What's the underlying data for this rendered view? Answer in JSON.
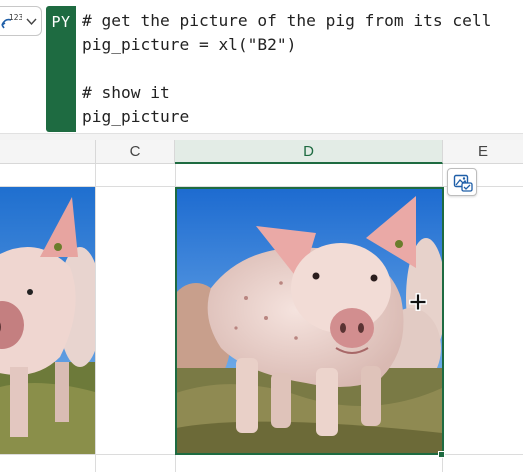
{
  "formula_bar": {
    "type_icon": "data-type-icon",
    "py_badge": "PY",
    "code_lines": [
      "# get the picture of the pig from its cell",
      "pig_picture = xl(\"B2\")",
      "",
      "# show it",
      "pig_picture"
    ]
  },
  "grid": {
    "columns": [
      {
        "label": "C",
        "selected": false
      },
      {
        "label": "D",
        "selected": true
      },
      {
        "label": "E",
        "selected": false
      }
    ],
    "picture_icon": "picture-options-icon",
    "cursor": "move-cursor-icon"
  },
  "colors": {
    "accent": "#1e6b41",
    "sky": "#2f7fd6"
  }
}
